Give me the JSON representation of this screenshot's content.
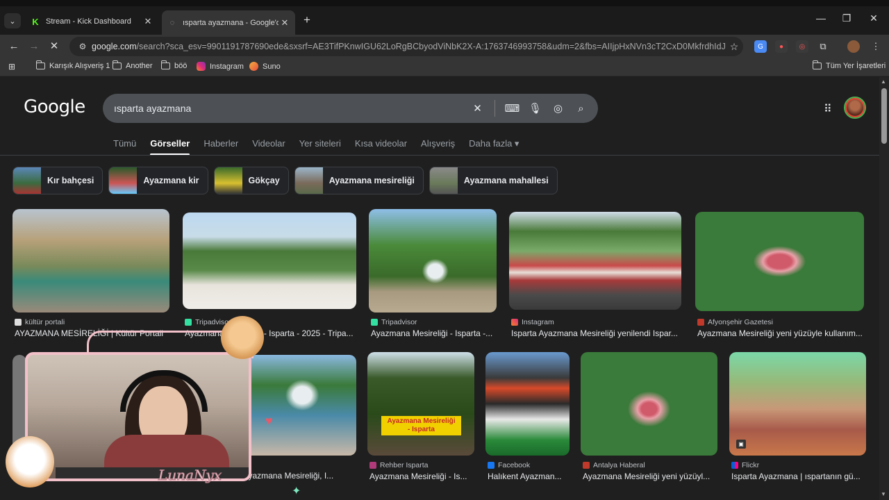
{
  "browser": {
    "tabs": [
      {
        "title": "Stream - Kick Dashboard",
        "favicon": "kick-icon"
      },
      {
        "title": "ısparta ayazmana - Google'da A",
        "favicon": "google-icon"
      }
    ],
    "url_main": "google.com",
    "url_rest": "/search?sca_esv=9901191787690ede&sxsrf=AE3TifPKnwIGU62LoRgBCbyodViNbK2X-A:1763746993758&udm=2&fbs=AIIjpHxNVn3cT2CxD0MkfrdhIdJ40HsTVSRr8..."
  },
  "bookmarks": {
    "items": [
      {
        "label": "Karışık Alışveriş 1",
        "icon": "folder-icon"
      },
      {
        "label": "Another",
        "icon": "folder-icon"
      },
      {
        "label": "böö",
        "icon": "folder-icon"
      },
      {
        "label": "Instagram",
        "icon": "instagram-icon"
      },
      {
        "label": "Suno",
        "icon": "suno-icon"
      }
    ],
    "all": "Tüm Yer İşaretleri"
  },
  "google": {
    "logo": "Google",
    "query": "ısparta ayazmana",
    "tabs": [
      "Tümü",
      "Görseller",
      "Haberler",
      "Videolar",
      "Yer siteleri",
      "Kısa videolar",
      "Alışveriş",
      "Daha fazla"
    ],
    "active_tab": "Görseller"
  },
  "chips": [
    "Kır bahçesi",
    "Ayazmana kir",
    "Gökçay",
    "Ayazmana mesireliği",
    "Ayazmana mahallesi"
  ],
  "results_row1": [
    {
      "source": "kültür portali",
      "caption": "AYAZMANA MESİRELİĞİ | Kültür Portali"
    },
    {
      "source": "Tripadvisor",
      "caption": "Ayazmana Mesireliği - Isparta - 2025 - Tripa..."
    },
    {
      "source": "Tripadvisor",
      "caption": "Ayazmana Mesireliği - Isparta -..."
    },
    {
      "source": "Instagram",
      "caption": "Isparta Ayazmana Mesireliği yenilendi Ispar..."
    },
    {
      "source": "Afyonşehir Gazetesi",
      "caption": "Ayazmana Mesireliği yeni yüzüyle kullanım..."
    }
  ],
  "results_row2": [
    {
      "source": "",
      "caption": "- Ayazmana Mesireliği, I..."
    },
    {
      "source": "Rehber Isparta",
      "caption": "Ayazmana Mesireliği - Is..."
    },
    {
      "source": "Facebook",
      "caption": "Halıkent Ayazman..."
    },
    {
      "source": "Antalya Haberal",
      "caption": "Ayazmana Mesireliği yeni yüzüyl..."
    },
    {
      "source": "Flickr",
      "caption": "Isparta Ayazmana | ıspartanın gü..."
    }
  ],
  "overlay": {
    "streamer_name": "LunaNyx",
    "image_text_1": "Ayazmana Mesireliği",
    "image_text_2": "- Isparta"
  }
}
